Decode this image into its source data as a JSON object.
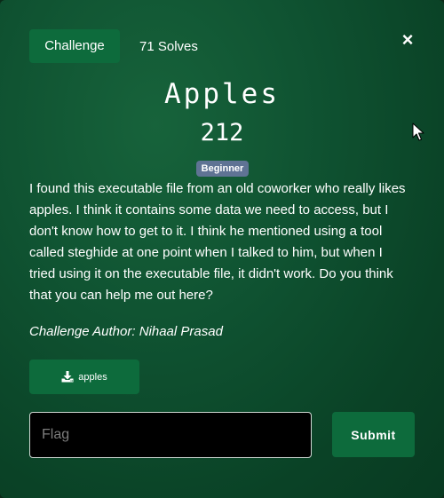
{
  "tabs": {
    "challenge_label": "Challenge",
    "solves_label": "71 Solves"
  },
  "close_label": "×",
  "challenge": {
    "name": "Apples",
    "points": "212",
    "difficulty": "Beginner",
    "description": "I found this executable file from an old coworker who really likes apples. I think it contains some data we need to access, but I don't know how to get to it. I think he mentioned using a tool called steghide at one point when I talked to him, but when I tried using it on the executable file, it didn't work. Do you think that you can help me out here?",
    "author": "Challenge Author: Nihaal Prasad"
  },
  "files": [
    {
      "label": "apples",
      "icon": "download-icon"
    }
  ],
  "flag_form": {
    "placeholder": "Flag",
    "value": "",
    "submit_label": "Submit"
  },
  "colors": {
    "accent": "#0d6b3c",
    "badge": "#5f7394",
    "background": "#0f5231"
  }
}
